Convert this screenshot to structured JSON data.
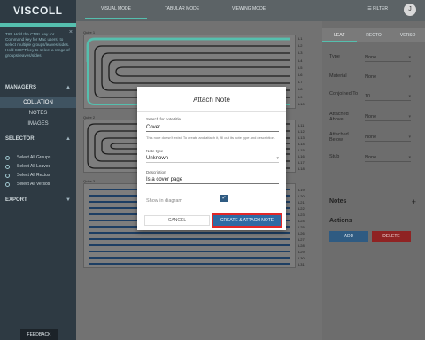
{
  "app": {
    "logo": "VISCOLL"
  },
  "sidebar": {
    "close_glyph": "×",
    "tip": "TIP: Hold the CTRL key (or Command key for Mac users) to select multiple groups/leaves/sides. Hold SHIFT key to select a range of groups/leaves/sides.",
    "managers": {
      "title": "MANAGERS",
      "items": [
        "COLLATION",
        "NOTES",
        "IMAGES"
      ],
      "active": "COLLATION"
    },
    "selector": {
      "title": "SELECTOR",
      "items": [
        "Select All Groups",
        "Select All Leaves",
        "Select All Rectos",
        "Select All Versos"
      ]
    },
    "export": {
      "title": "EXPORT"
    },
    "feedback": "FEEDBACK"
  },
  "topbar": {
    "tabs": [
      "VISUAL MODE",
      "TABULAR MODE",
      "VIEWING MODE"
    ],
    "active_tab": "VISUAL MODE",
    "filter": "FILTER",
    "avatar": "J"
  },
  "canvas": {
    "groups": [
      {
        "label": "Quire 1",
        "leaf_labels": [
          "L1",
          "L2",
          "L3",
          "L4",
          "L5",
          "L6",
          "L7",
          "L8",
          "L9",
          "L10"
        ]
      },
      {
        "label": "Quire 2",
        "leaf_labels": [
          "L11",
          "L12",
          "L13",
          "L14",
          "L15",
          "L16",
          "L17",
          "L18"
        ]
      },
      {
        "label": "Quire 3",
        "leaf_labels": [
          "L19",
          "L20",
          "L21",
          "L22",
          "L23",
          "L24",
          "L25",
          "L26",
          "L27",
          "L28",
          "L29",
          "L30",
          "L31"
        ]
      }
    ],
    "highlight_color": "#55bfae"
  },
  "panel": {
    "tabs": [
      "LEAF",
      "RECTO",
      "VERSO"
    ],
    "active_tab": "LEAF",
    "rows": [
      {
        "label": "Type",
        "value": "None"
      },
      {
        "label": "Material",
        "value": "None"
      },
      {
        "label": "Conjoined To",
        "value": "10"
      },
      {
        "label": "Attached Above",
        "value": "None"
      },
      {
        "label": "Attached Below",
        "value": "None"
      },
      {
        "label": "Stub",
        "value": "None"
      }
    ],
    "notes_title": "Notes",
    "actions_title": "Actions",
    "add_label": "ADD",
    "delete_label": "DELETE"
  },
  "modal": {
    "title": "Attach Note",
    "search_label": "Search for note title",
    "search_value": "Cover",
    "hint": "This note doesn't exist. To create and attach it, fill out its note type and description.",
    "type_label": "Note type",
    "type_value": "Unknown",
    "desc_label": "Description",
    "desc_value": "Is a cover page",
    "show_label": "Show in diagram",
    "show_checked": true,
    "cancel_label": "CANCEL",
    "create_label": "CREATE & ATTACH NOTE"
  }
}
